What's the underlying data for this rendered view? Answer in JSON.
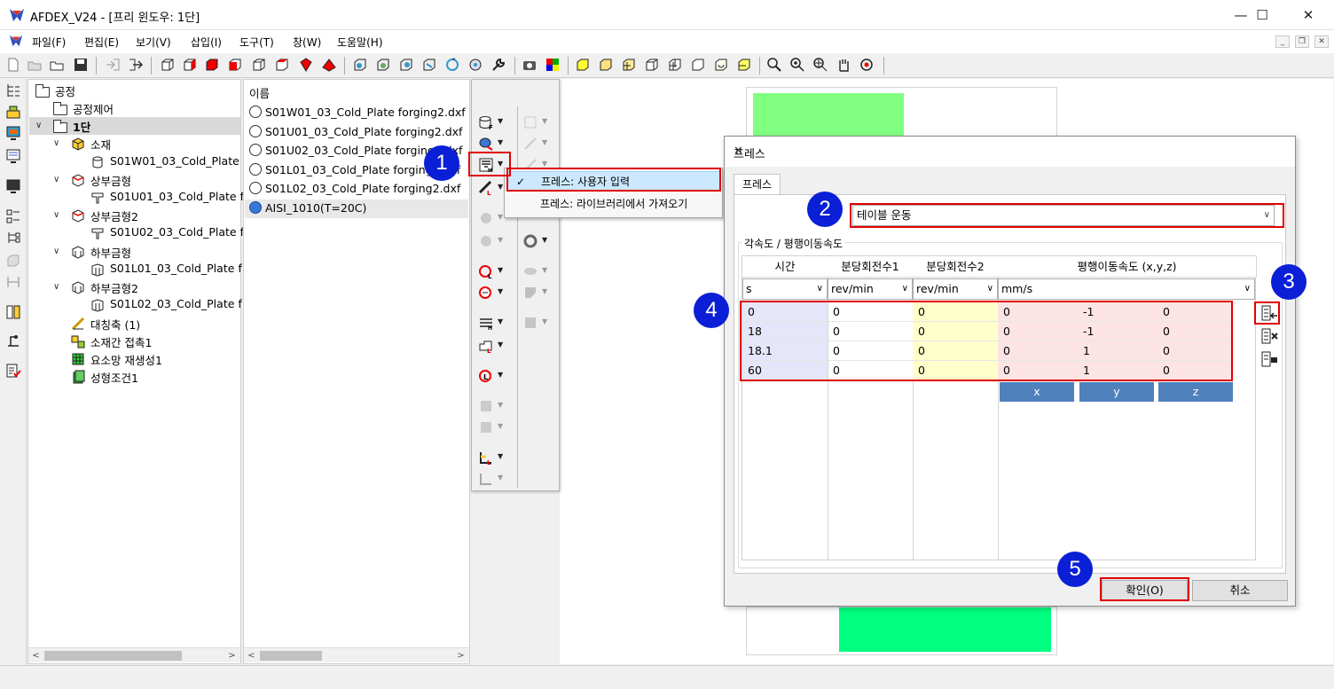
{
  "window": {
    "title": "AFDEX_V24 - [프리 윈도우: 1단]",
    "minimize": "—",
    "maximize": "☐",
    "close": "✕"
  },
  "menu": [
    "파일(F)",
    "편집(E)",
    "보기(V)",
    "삽입(I)",
    "도구(T)",
    "창(W)",
    "도움말(H)"
  ],
  "tree": {
    "root": "공정",
    "control": "공정제어",
    "stage": "1단",
    "material": "소재",
    "material_file": "S01W01_03_Cold_Plate",
    "upper1": "상부금형",
    "upper1_file": "S01U01_03_Cold_Plate f",
    "upper2": "상부금형2",
    "upper2_file": "S01U02_03_Cold_Plate f",
    "lower1": "하부금형",
    "lower1_file": "S01L01_03_Cold_Plate f",
    "lower2": "하부금형2",
    "lower2_file": "S01L02_03_Cold_Plate f",
    "symmetry": "대칭축 (1)",
    "contact": "소재간 접촉1",
    "remesh": "요소망 재생성1",
    "condition": "성형조건1"
  },
  "list": {
    "header": "이름",
    "items": [
      "S01W01_03_Cold_Plate forging2.dxf",
      "S01U01_03_Cold_Plate forging2.dxf",
      "S01U02_03_Cold_Plate forging2.dxf",
      "S01L01_03_Cold_Plate forging2.dxf",
      "S01L02_03_Cold_Plate forging2.dxf",
      "AISI_1010(T=20C)"
    ]
  },
  "press_menu": {
    "user_input": "프레스: 사용자 입력",
    "library": "프레스: 라이브러리에서 가져오기",
    "check": "✓"
  },
  "dialog": {
    "title": "프레스",
    "tab": "프레스",
    "motion_type": "테이블 운동",
    "group_label": "각속도 / 평행이동속도",
    "columns": [
      "시간",
      "분당회전수1",
      "분당회전수2",
      "평행이동속도 (x,y,z)"
    ],
    "units": [
      "s",
      "rev/min",
      "rev/min",
      "mm/s"
    ],
    "rows": [
      {
        "t": "0",
        "r1": "0",
        "r2": "0",
        "x": "0",
        "y": "-1",
        "z": "0"
      },
      {
        "t": "18",
        "r1": "0",
        "r2": "0",
        "x": "0",
        "y": "-1",
        "z": "0"
      },
      {
        "t": "18.1",
        "r1": "0",
        "r2": "0",
        "x": "0",
        "y": "1",
        "z": "0"
      },
      {
        "t": "60",
        "r1": "0",
        "r2": "0",
        "x": "0",
        "y": "1",
        "z": "0"
      }
    ],
    "xyz": [
      "x",
      "y",
      "z"
    ],
    "ok": "확인(O)",
    "cancel": "취소"
  },
  "badges": [
    "1",
    "2",
    "3",
    "4",
    "5"
  ],
  "colors": {
    "badge": "#0a1fd6",
    "highlight": "#e00000",
    "time_col": "#e6e6fa",
    "rpm2_col": "#ffffcc",
    "velocity_col": "#fde4e4",
    "xyz_button": "#4f81bd",
    "sheet_green": "#00ff80"
  }
}
